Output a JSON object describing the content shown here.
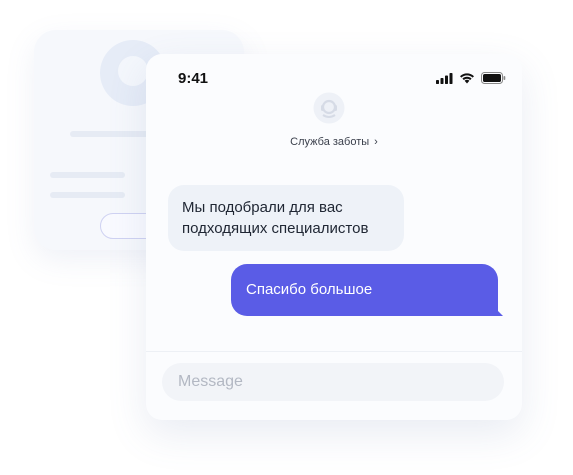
{
  "status_bar": {
    "time": "9:41"
  },
  "agent": {
    "name": "Служба заботы",
    "chevron": "›",
    "avatar_icon": "support-headset-icon"
  },
  "messages": [
    {
      "direction": "incoming",
      "text": "Мы подобрали для вас подходящих специалистов"
    },
    {
      "direction": "outgoing",
      "text": "Спасибо большое"
    }
  ],
  "composer": {
    "placeholder": "Message",
    "value": ""
  },
  "colors": {
    "outgoing_bubble": "#5a5ce6",
    "incoming_bubble": "#eef2f8",
    "background": "#ffffff"
  }
}
